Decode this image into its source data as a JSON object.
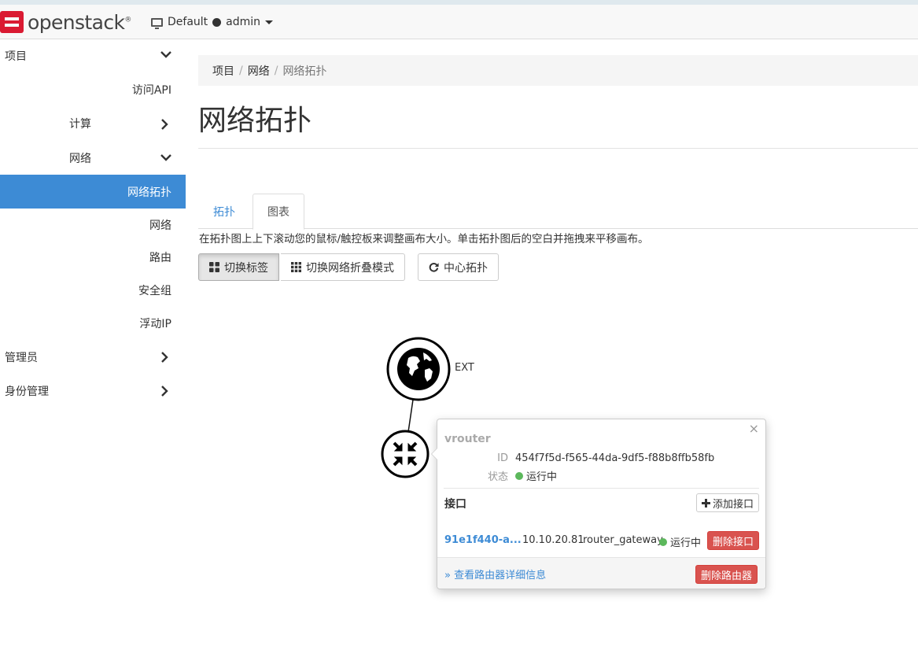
{
  "header": {
    "brand": "openstack",
    "domain_label": "Default",
    "user_label": "admin"
  },
  "sidebar": {
    "project": "项目",
    "access_api": "访问API",
    "compute": "计算",
    "network": "网络",
    "network_topology": "网络拓扑",
    "networks": "网络",
    "routers": "路由",
    "security_groups": "安全组",
    "floating_ips": "浮动IP",
    "admin": "管理员",
    "identity": "身份管理"
  },
  "breadcrumb": {
    "items": [
      "项目",
      "网络",
      "网络拓扑"
    ]
  },
  "page": {
    "title": "网络拓扑",
    "tabs": [
      "拓扑",
      "图表"
    ],
    "hint": "在拓扑图上上下滚动您的鼠标/触控板来调整画布大小。单击拓扑图后的空白并拖拽来平移画布。",
    "buttons": {
      "toggle_labels": "切换标签",
      "toggle_collapse": "切换网络折叠模式",
      "center": "中心拓扑"
    }
  },
  "topology": {
    "external_network_label": "EXT"
  },
  "popover": {
    "close": "×",
    "router_name": "vrouter",
    "id_label": "ID",
    "id_value": "454f7f5d-f565-44da-9df5-f88b8ffb58fb",
    "status_label": "状态",
    "status_value": "运行中",
    "interfaces_heading": "接口",
    "add_interface": "添加接口",
    "interface": {
      "port": "91e1f440-a...",
      "ip": "10.10.20.81",
      "type": "router_gateway",
      "status": "运行中",
      "delete": "删除接口"
    },
    "detail_link": "» 查看路由器详细信息",
    "delete_router": "删除路由器"
  },
  "colors": {
    "accent": "#3d8bd5",
    "danger": "#d9534f",
    "status_ok": "#5cb85c",
    "brand_red": "#da1a32"
  }
}
